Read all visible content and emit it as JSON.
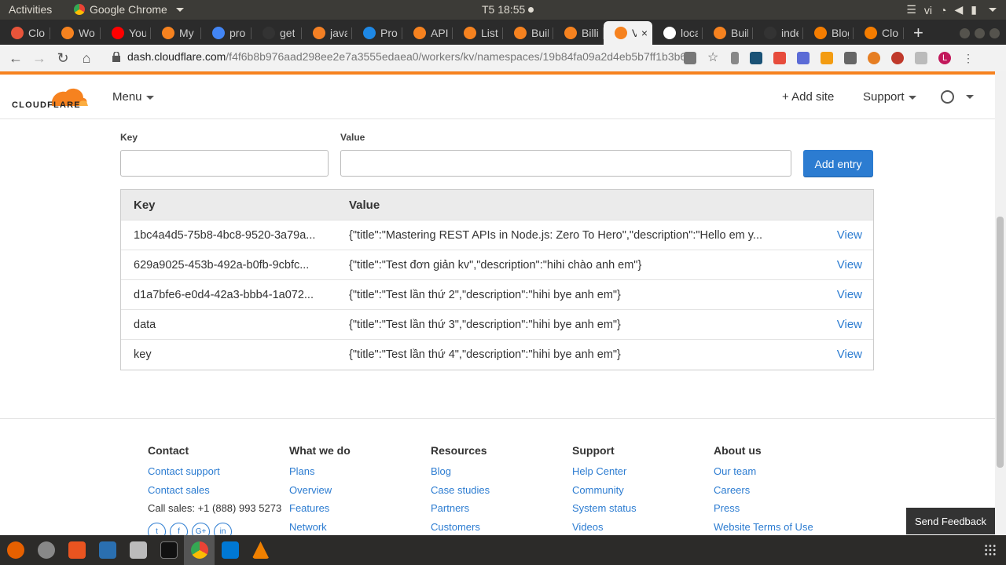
{
  "os": {
    "activities": "Activities",
    "app_name": "Google Chrome",
    "clock": "T5 18:55",
    "lang": "vi"
  },
  "tabs": [
    {
      "label": "Clo",
      "color": "#e8543a"
    },
    {
      "label": "Wo",
      "color": "#f6821f"
    },
    {
      "label": "You",
      "color": "#ff0000"
    },
    {
      "label": "My",
      "color": "#f6821f"
    },
    {
      "label": "pro",
      "color": "#4285f4"
    },
    {
      "label": "get",
      "color": "#333333"
    },
    {
      "label": "java",
      "color": "#f48024"
    },
    {
      "label": "Pro",
      "color": "#1e88e5"
    },
    {
      "label": "API",
      "color": "#f6821f"
    },
    {
      "label": "List",
      "color": "#f6821f"
    },
    {
      "label": "Buil",
      "color": "#f6821f"
    },
    {
      "label": "Billi",
      "color": "#f6821f"
    },
    {
      "label": "V",
      "color": "#f6821f",
      "active": true
    },
    {
      "label": "loca",
      "color": "#ffffff"
    },
    {
      "label": "Buil",
      "color": "#f6821f"
    },
    {
      "label": "inde",
      "color": "#333333"
    },
    {
      "label": "Blog",
      "color": "#f57d00"
    },
    {
      "label": "Clo",
      "color": "#f57d00"
    }
  ],
  "browser": {
    "url_host": "dash.cloudflare.com",
    "url_path": "/f4f6b8b976aad298ee2e7a3555edaea0/workers/kv/namespaces/19b84fa09a2d4eb5b7ff1b3b6..."
  },
  "header": {
    "logo_text": "CLOUDFLARE",
    "menu": "Menu",
    "add_site": "+ Add site",
    "support": "Support"
  },
  "form": {
    "key_label": "Key",
    "value_label": "Value",
    "key_value": "",
    "value_value": "",
    "add_button": "Add entry"
  },
  "table": {
    "headers": [
      "Key",
      "Value"
    ],
    "view_label": "View",
    "rows": [
      {
        "key": "1bc4a4d5-75b8-4bc8-9520-3a79a...",
        "value": "{\"title\":\"Mastering REST APIs in Node.js: Zero To Hero\",\"description\":\"Hello em y..."
      },
      {
        "key": "629a9025-453b-492a-b0fb-9cbfc...",
        "value": "{\"title\":\"Test đơn giản kv\",\"description\":\"hihi chào anh em\"}"
      },
      {
        "key": "d1a7bfe6-e0d4-42a3-bbb4-1a072...",
        "value": "{\"title\":\"Test lần thứ 2\",\"description\":\"hihi bye anh em\"}"
      },
      {
        "key": "data",
        "value": "{\"title\":\"Test lần thứ 3\",\"description\":\"hihi bye anh em\"}"
      },
      {
        "key": "key",
        "value": "{\"title\":\"Test lần thứ 4\",\"description\":\"hihi bye anh em\"}"
      }
    ]
  },
  "footer": {
    "contact": {
      "title": "Contact",
      "links": [
        "Contact support",
        "Contact sales"
      ],
      "phone": "Call sales: +1 (888) 993 5273"
    },
    "what": {
      "title": "What we do",
      "links": [
        "Plans",
        "Overview",
        "Features",
        "Network"
      ]
    },
    "resources": {
      "title": "Resources",
      "links": [
        "Blog",
        "Case studies",
        "Partners",
        "Customers"
      ]
    },
    "support": {
      "title": "Support",
      "links": [
        "Help Center",
        "Community",
        "System status",
        "Videos"
      ]
    },
    "about": {
      "title": "About us",
      "links": [
        "Our team",
        "Careers",
        "Press",
        "Website Terms of Use"
      ]
    },
    "social": [
      "t",
      "f",
      "G+",
      "in"
    ]
  },
  "feedback": "Send Feedback",
  "colors": {
    "accent": "#2c7cd1",
    "brand_orange": "#f6821f"
  }
}
